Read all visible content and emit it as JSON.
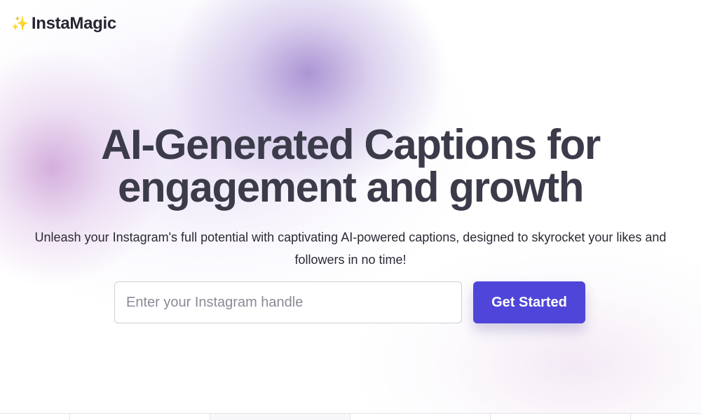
{
  "brand": {
    "icon": "sparkles-icon",
    "icon_glyph": "✨",
    "name": "InstaMagic"
  },
  "hero": {
    "title_line1": "AI-Generated Captions for",
    "title_line2": "engagement and growth",
    "subtitle": "Unleash your Instagram's full potential with captivating AI-powered captions, designed to skyrocket your likes and followers in no time!"
  },
  "signup": {
    "input_placeholder": "Enter your Instagram handle",
    "input_value": "",
    "button_label": "Get Started"
  },
  "colors": {
    "accent": "#4f46d9",
    "heading": "#3b3b4a",
    "glow_purple": "#a084cd",
    "glow_pink": "#c896d2"
  }
}
